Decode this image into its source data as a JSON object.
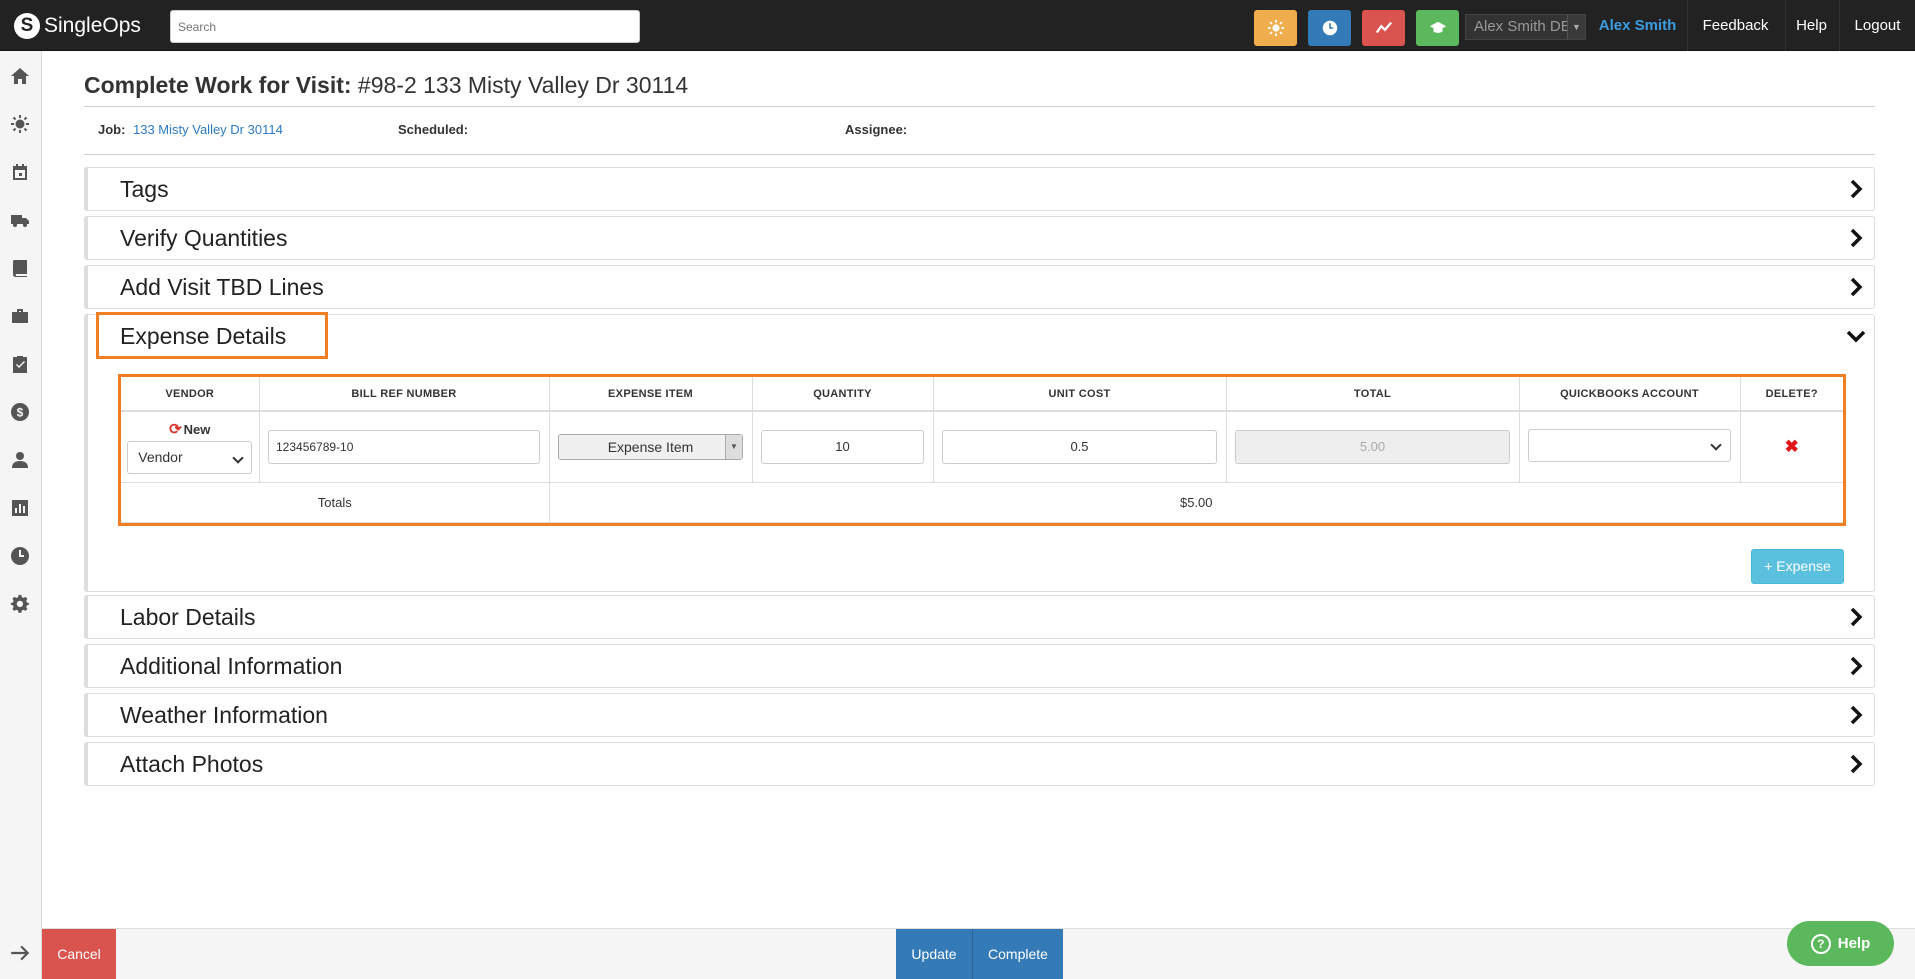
{
  "app": {
    "name": "SingleOps"
  },
  "topbar": {
    "search_placeholder": "Search",
    "quick_buttons": [
      {
        "name": "weather",
        "color": "#f0ad4e",
        "icon": "sun-icon"
      },
      {
        "name": "timesheet",
        "color": "#337ab7",
        "icon": "clock-icon"
      },
      {
        "name": "reports",
        "color": "#d9534f",
        "icon": "trend-icon"
      },
      {
        "name": "training",
        "color": "#5cb85c",
        "icon": "graduation-cap-icon"
      }
    ],
    "user_select_value": "Alex Smith DE",
    "user_name": "Alex Smith",
    "feedback": "Feedback",
    "help": "Help",
    "logout": "Logout"
  },
  "sidebar": {
    "icons": [
      "home-icon",
      "sun-icon",
      "calendar-icon",
      "truck-icon",
      "book-icon",
      "briefcase-icon",
      "clipboard-check-icon",
      "dollar-icon",
      "user-icon",
      "bar-chart-icon",
      "clock-icon",
      "gear-icon"
    ]
  },
  "header": {
    "title_prefix": "Complete Work for Visit:",
    "title_value": "#98-2 133 Misty Valley Dr 30114",
    "job_label": "Job:",
    "job_value": "133 Misty Valley Dr 30114",
    "scheduled_label": "Scheduled:",
    "assignee_label": "Assignee:"
  },
  "panels": {
    "tags": "Tags",
    "verify_quantities": "Verify Quantities",
    "add_visit_tbd": "Add Visit TBD Lines",
    "expense_details": "Expense Details",
    "labor_details": "Labor Details",
    "additional_info": "Additional Information",
    "weather_info": "Weather Information",
    "attach_photos": "Attach Photos"
  },
  "expense_table": {
    "columns": [
      "VENDOR",
      "BILL REF NUMBER",
      "EXPENSE ITEM",
      "QUANTITY",
      "UNIT COST",
      "TOTAL",
      "QUICKBOOKS ACCOUNT",
      "DELETE?"
    ],
    "row": {
      "new_label": "New",
      "vendor": "Vendor",
      "bill_ref": "123456789-10",
      "expense_item": "Expense Item",
      "quantity": "10",
      "unit_cost": "0.5",
      "total": "5.00",
      "quickbooks_account": "",
      "delete_symbol": "✖"
    },
    "totals_label": "Totals",
    "totals_value": "$5.00",
    "add_button": "+ Expense"
  },
  "footer": {
    "cancel": "Cancel",
    "update": "Update",
    "complete": "Complete",
    "help_widget": "Help"
  },
  "colors": {
    "highlight": "#f17e22",
    "accent_blue": "#337ab7",
    "danger": "#d9534f",
    "info": "#5bc0de",
    "success": "#5cb85c"
  }
}
